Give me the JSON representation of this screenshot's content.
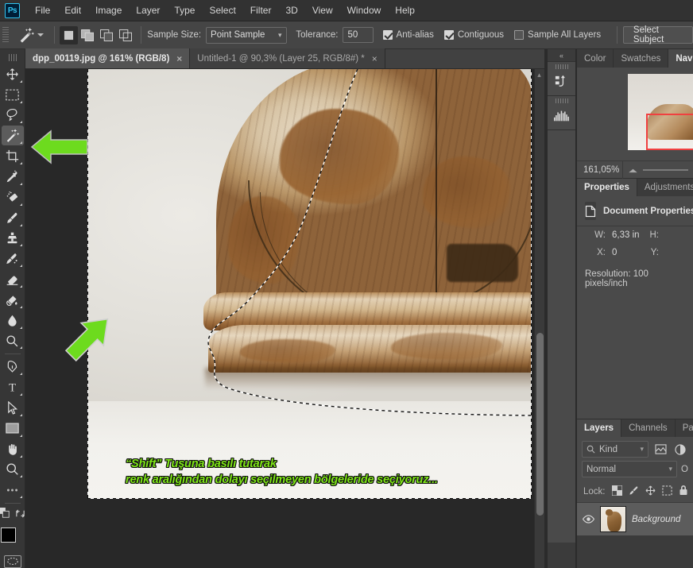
{
  "app": {
    "name": "Adobe Photoshop",
    "logo_text": "Ps"
  },
  "menubar": {
    "items": [
      "File",
      "Edit",
      "Image",
      "Layer",
      "Type",
      "Select",
      "Filter",
      "3D",
      "View",
      "Window",
      "Help"
    ]
  },
  "options_bar": {
    "tool_icon": "magic-wand-icon",
    "selection_modes": [
      "new-selection",
      "add-to-selection",
      "subtract-from-selection",
      "intersect-with-selection"
    ],
    "active_selection_mode": "new-selection",
    "sample_size_label": "Sample Size:",
    "sample_size_value": "Point Sample",
    "tolerance_label": "Tolerance:",
    "tolerance_value": "50",
    "anti_alias_label": "Anti-alias",
    "anti_alias_checked": true,
    "contiguous_label": "Contiguous",
    "contiguous_checked": true,
    "sample_all_layers_label": "Sample All Layers",
    "sample_all_layers_checked": false,
    "select_subject_label": "Select Subject"
  },
  "document_tabs": [
    {
      "label": "dpp_00119.jpg @ 161% (RGB/8)",
      "active": true,
      "close": "×"
    },
    {
      "label": "Untitled-1 @ 90,3% (Layer 25, RGB/8#) *",
      "active": false,
      "close": "×"
    }
  ],
  "toolbar": {
    "tools": [
      {
        "name": "move-tool",
        "active": false
      },
      {
        "name": "rectangular-marquee-tool",
        "active": false
      },
      {
        "name": "lasso-tool",
        "active": false
      },
      {
        "name": "magic-wand-tool",
        "active": true
      },
      {
        "name": "crop-tool",
        "active": false
      },
      {
        "name": "eyedropper-tool",
        "active": false
      },
      {
        "name": "spot-healing-brush-tool",
        "active": false
      },
      {
        "name": "brush-tool",
        "active": false
      },
      {
        "name": "clone-stamp-tool",
        "active": false
      },
      {
        "name": "history-brush-tool",
        "active": false
      },
      {
        "name": "eraser-tool",
        "active": false
      },
      {
        "name": "gradient-tool",
        "active": false
      },
      {
        "name": "blur-tool",
        "active": false
      },
      {
        "name": "dodge-tool",
        "active": false
      },
      {
        "name": "pen-tool",
        "active": false
      },
      {
        "name": "horizontal-type-tool",
        "active": false
      },
      {
        "name": "path-selection-tool",
        "active": false
      },
      {
        "name": "rectangle-tool",
        "active": false
      },
      {
        "name": "hand-tool",
        "active": false
      },
      {
        "name": "zoom-tool",
        "active": false
      },
      {
        "name": "edit-toolbar-tool",
        "active": false
      }
    ],
    "foreground_color": "#000000",
    "background_color": "#ffffff",
    "quick_mask_name": "quick-mask-mode"
  },
  "canvas": {
    "annotation_text_line1": "“Shift” Tuşuna basılı tutarak",
    "annotation_text_line2": "renk aralığından dolayı seçilmeyen bölgeleride seçiyoruz...",
    "annotation_color": "#7ee617",
    "arrow_left_name": "green-arrow-left",
    "arrow_up_name": "green-arrow-up-right",
    "selection_name": "marching-ants-selection",
    "subject": "carved wooden furniture post on white backdrop"
  },
  "mini_dock": {
    "collapse_label": "«",
    "icons": [
      "history-icon",
      "histogram-icon"
    ]
  },
  "navigator_panel": {
    "tabs": [
      {
        "label": "Color",
        "active": false
      },
      {
        "label": "Swatches",
        "active": false
      },
      {
        "label": "Navigator",
        "active": true
      }
    ],
    "zoom_value": "161,05%",
    "view_rect_color": "#f04040"
  },
  "properties_panel": {
    "tabs": [
      {
        "label": "Properties",
        "active": true
      },
      {
        "label": "Adjustments",
        "active": false
      }
    ],
    "header_title": "Document Properties",
    "header_icon": "document-icon",
    "w_label": "W:",
    "w_value": "6,33 in",
    "h_label": "H:",
    "h_value": "",
    "x_label": "X:",
    "x_value": "0",
    "y_label": "Y:",
    "y_value": "",
    "resolution_text": "Resolution: 100 pixels/inch"
  },
  "layers_panel": {
    "tabs": [
      {
        "label": "Layers",
        "active": true
      },
      {
        "label": "Channels",
        "active": false
      },
      {
        "label": "Paths",
        "active": false
      }
    ],
    "filter_placeholder": "Kind",
    "filter_icons": [
      "pixel-layer-filter-icon",
      "adjustment-layer-filter-icon"
    ],
    "blend_mode": "Normal",
    "lock_label": "Lock:",
    "lock_icons": [
      "lock-transparent-pixels-icon",
      "lock-image-pixels-icon",
      "lock-position-icon",
      "lock-artboard-icon",
      "lock-all-icon"
    ],
    "layers": [
      {
        "name": "Background",
        "visible": true,
        "thumb": "cat-photo-thumbnail"
      }
    ]
  },
  "scrollbar": {
    "name": "canvas-vertical-scrollbar"
  }
}
